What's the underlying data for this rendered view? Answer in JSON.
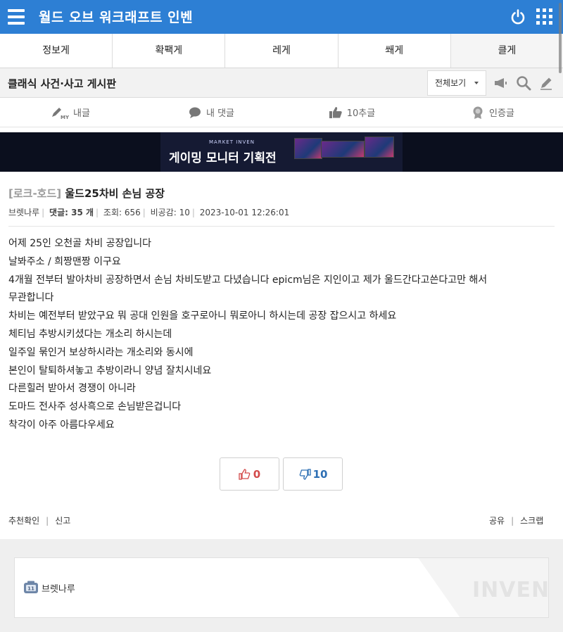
{
  "header": {
    "title": "월드 오브 워크래프트 인벤",
    "power_icon": "power-icon",
    "apps_icon": "grid-icon"
  },
  "categories": [
    "정보게",
    "확팩게",
    "레게",
    "쐐게",
    "클게"
  ],
  "board": {
    "title": "클래식 사건·사고 게시판",
    "view_select": "전체보기"
  },
  "tools": [
    {
      "label": "내글",
      "icon": "my-post-icon"
    },
    {
      "label": "내 댓글",
      "icon": "comment-icon"
    },
    {
      "label": "10추글",
      "icon": "thumbs-up-icon"
    },
    {
      "label": "인증글",
      "icon": "medal-icon"
    }
  ],
  "banner": {
    "small": "MARKET INVEN",
    "main": "게이밍 모니터 기획전"
  },
  "post": {
    "tag": "[로크-호드]",
    "title": "울드25차비 손님 공장",
    "author": "브렛나루",
    "comments_label": "댓글:",
    "comments": "35 개",
    "views": "조회: 656",
    "dislikes": "비공감: 10",
    "date": "2023-10-01 12:26:01",
    "content": [
      "어제 25인 오천골 차비 공장입니다",
      "날봐주소 /  희짱맨짱   이구요",
      "4개월 전부터 발아차비 공장하면서 손님 차비도받고 다녔습니다  epicm님은 지인이고 제가 울드간다고쓴다고만 해서",
      "무관합니다",
      "차비는 예전부터 받았구요 뭐 공대 인원을 호구로아니 뭐로아니 하시는데  공장 잡으시고 하세요",
      "체티님 추방시키셨다는 개소리 하시는데",
      "일주일 묶인거 보상하시라는 개소리와 동시에",
      "본인이 탈퇴하셔놓고 추방이라니 양념 잘치시네요",
      "다른힐러 받아서 경쟁이 아니라",
      "도마드 전사주 성사흑으로 손님받은겁니다",
      "착각이 아주 아름다우세요"
    ],
    "upvotes": "0",
    "downvotes": "10"
  },
  "actions": {
    "recommend_check": "추천확인",
    "report": "신고",
    "share": "공유",
    "scrap": "스크랩"
  },
  "author_box": {
    "name": "브렛나루",
    "watermark": "INVEN"
  },
  "colors": {
    "header_bg": "#2d7fd4",
    "upvote": "#d34a4a",
    "downvote": "#2d6fb4"
  }
}
